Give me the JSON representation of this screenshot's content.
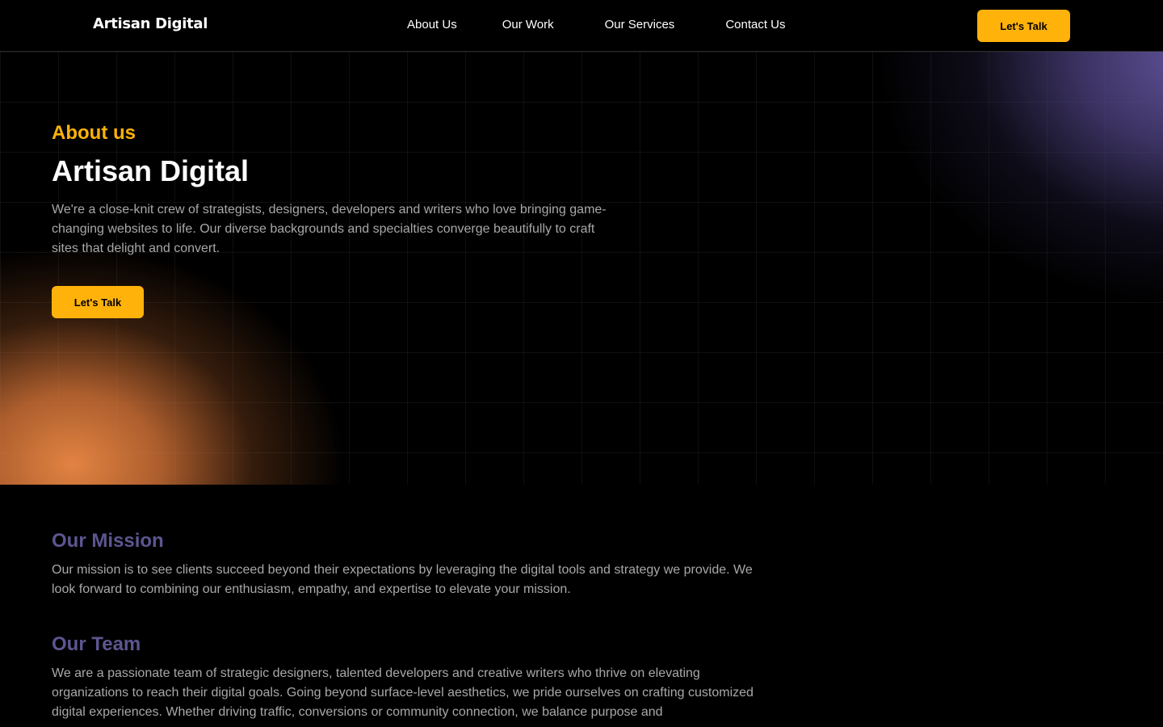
{
  "header": {
    "logo": "Artisan Digital",
    "nav": [
      "About Us",
      "Our Work",
      "Our Services",
      "Contact Us"
    ],
    "cta_label": "Let's Talk"
  },
  "hero": {
    "eyebrow": "About us",
    "title": "Artisan Digital",
    "description": "We're a close-knit crew of strategists, designers, developers and writers who love bringing game-changing websites to life. Our diverse backgrounds and specialties converge beautifully to craft sites that delight and convert.",
    "cta_label": "Let's Talk"
  },
  "mission": {
    "heading": "Our Mission",
    "text": "Our mission is to see clients succeed beyond their expectations by leveraging the digital tools and strategy we provide. We look forward to combining our enthusiasm, empathy, and expertise to elevate your mission."
  },
  "team": {
    "heading": "Our Team",
    "text": "We are a passionate team of strategic designers, talented developers and creative writers who thrive on elevating organizations to reach their digital goals. Going beyond surface-level aesthetics, we pride ourselves on crafting customized digital experiences. Whether driving traffic, conversions or community connection, we balance purpose and"
  },
  "colors": {
    "accent": "#ffb20a",
    "heading_purple": "#5c5690",
    "background": "#000000",
    "body_text": "#a8a8a8"
  }
}
